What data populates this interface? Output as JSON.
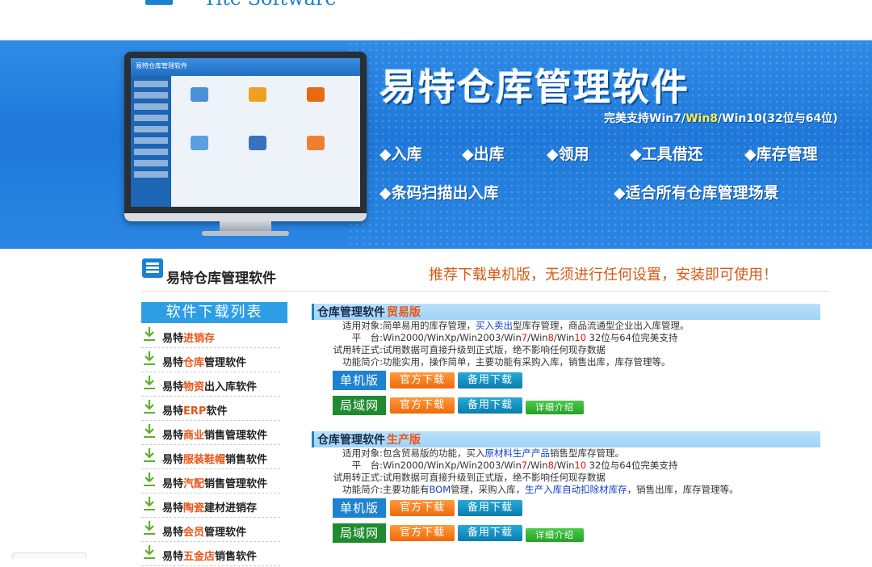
{
  "logo": {
    "text": "Yite Software"
  },
  "banner": {
    "title": "易特仓库管理软件",
    "support_prefix": "完美支持",
    "support_win7": "Win7",
    "support_slash1": "/",
    "support_win8": "Win8",
    "support_slash2": "/",
    "support_win10": "Win10",
    "support_suffix": "(32位与64位)",
    "features": [
      "◆入库",
      "◆出库",
      "◆领用",
      "◆工具借还",
      "◆库存管理",
      "◆条码扫描出入库",
      "◆适合所有仓库管理场景"
    ],
    "screen_title": "易特仓库管理软件"
  },
  "section": {
    "title": "易特仓库管理软件",
    "slogan": "推荐下载单机版，无须进行任何设置，安装即可使用！"
  },
  "download_list": {
    "header": "软件下载列表",
    "items": [
      {
        "pre": "易特",
        "hl": "进销存",
        "post": ""
      },
      {
        "pre": "易特",
        "hl": "仓库",
        "post": "管理软件"
      },
      {
        "pre": "易特",
        "hl": "物资",
        "post": "出入库软件"
      },
      {
        "pre": "易特",
        "hl": "ERP",
        "post": "软件"
      },
      {
        "pre": "易特",
        "hl": "商业",
        "post": "销售管理软件"
      },
      {
        "pre": "易特",
        "hl": "服装鞋帽",
        "post": "销售软件"
      },
      {
        "pre": "易特",
        "hl": "汽配",
        "post": "销售管理软件"
      },
      {
        "pre": "易特",
        "hl": "陶瓷",
        "post": "建材进销存"
      },
      {
        "pre": "易特",
        "hl": "会员",
        "post": "管理软件"
      },
      {
        "pre": "易特",
        "hl": "五金店",
        "post": "销售软件"
      }
    ]
  },
  "products": [
    {
      "name": "仓库管理软件",
      "edition": "贸易版",
      "target_label": "适用对象:",
      "target_pre": "简单易用的库存管理，",
      "target_link": "买入卖出",
      "target_post": "型库存管理，商品流通型企业出入库管理。",
      "platform_label": "平　台:",
      "platform_a": "Win2000/WinXp/Win2003/Win",
      "platform_7": "7",
      "platform_b": "/Win",
      "platform_8": "8",
      "platform_c": "/Win",
      "platform_10": "10",
      "platform_d": "  32位与64位完美支持",
      "trial_label": "试用转正式:",
      "trial": "试用数据可直接升级到正式版，绝不影响任何现存数据",
      "func_label": "功能简介:",
      "func_pre": "功能实用，操作简单，主要功能有采购入库，销售出库，库存管理等。",
      "func_link1": "",
      "func_mid": "",
      "func_link2": "",
      "func_post": "",
      "single_label": "单机版",
      "lan_label": "局域网",
      "official_download": "官方下载",
      "backup_download": "备用下载",
      "details": "详细介绍"
    },
    {
      "name": "仓库管理软件",
      "edition": "生产版",
      "target_label": "适用对象:",
      "target_pre": "包含贸易版的功能，买入",
      "target_link": "原材料生产产品",
      "target_post": "销售型库存管理。",
      "platform_label": "平　台:",
      "platform_a": "Win2000/WinXp/Win2003/Win",
      "platform_7": "7",
      "platform_b": "/Win",
      "platform_8": "8",
      "platform_c": "/Win",
      "platform_10": "10",
      "platform_d": "  32位与64位完美支持",
      "trial_label": "试用转正式:",
      "trial": "试用数据可直接升级到正式版，绝不影响任何现存数据",
      "func_label": "功能简介:",
      "func_pre": "主要功能有",
      "func_link1": "BOM",
      "func_mid": "管理，采购入库，",
      "func_link2": "生产入库自动扣除材库存",
      "func_post": "，销售出库，库存管理等。",
      "single_label": "单机版",
      "lan_label": "局域网",
      "official_download": "官方下载",
      "backup_download": "备用下载",
      "details": "详细介绍"
    }
  ]
}
